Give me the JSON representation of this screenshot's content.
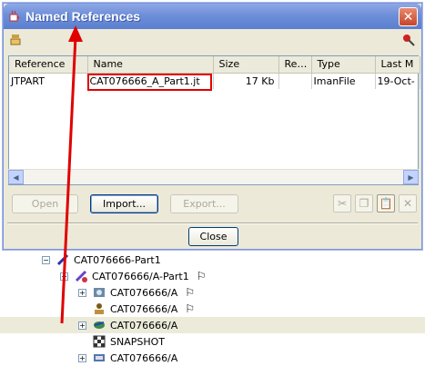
{
  "dialog": {
    "title": "Named References",
    "columns": [
      "Reference",
      "Name",
      "Size",
      "Re…",
      "Type",
      "Last M"
    ],
    "rows": [
      {
        "reference": "JTPART",
        "name": "CAT076666_A_Part1.jt",
        "size": "17 Kb",
        "re": "",
        "type": "ImanFile",
        "last": "19-Oct-"
      }
    ],
    "buttons": {
      "open": "Open",
      "import": "Import...",
      "export": "Export...",
      "close": "Close"
    }
  },
  "tree": {
    "items": [
      {
        "label": "CAT076666-Part1"
      },
      {
        "label": "CAT076666/A-Part1"
      },
      {
        "label": "CAT076666/A"
      },
      {
        "label": "CAT076666/A"
      },
      {
        "label": "CAT076666/A"
      },
      {
        "label": "SNAPSHOT"
      },
      {
        "label": "CAT076666/A"
      }
    ]
  },
  "colors": {
    "titlebar": "#6e8fd9",
    "highlight": "#e00000",
    "arrow": "#e00000"
  }
}
